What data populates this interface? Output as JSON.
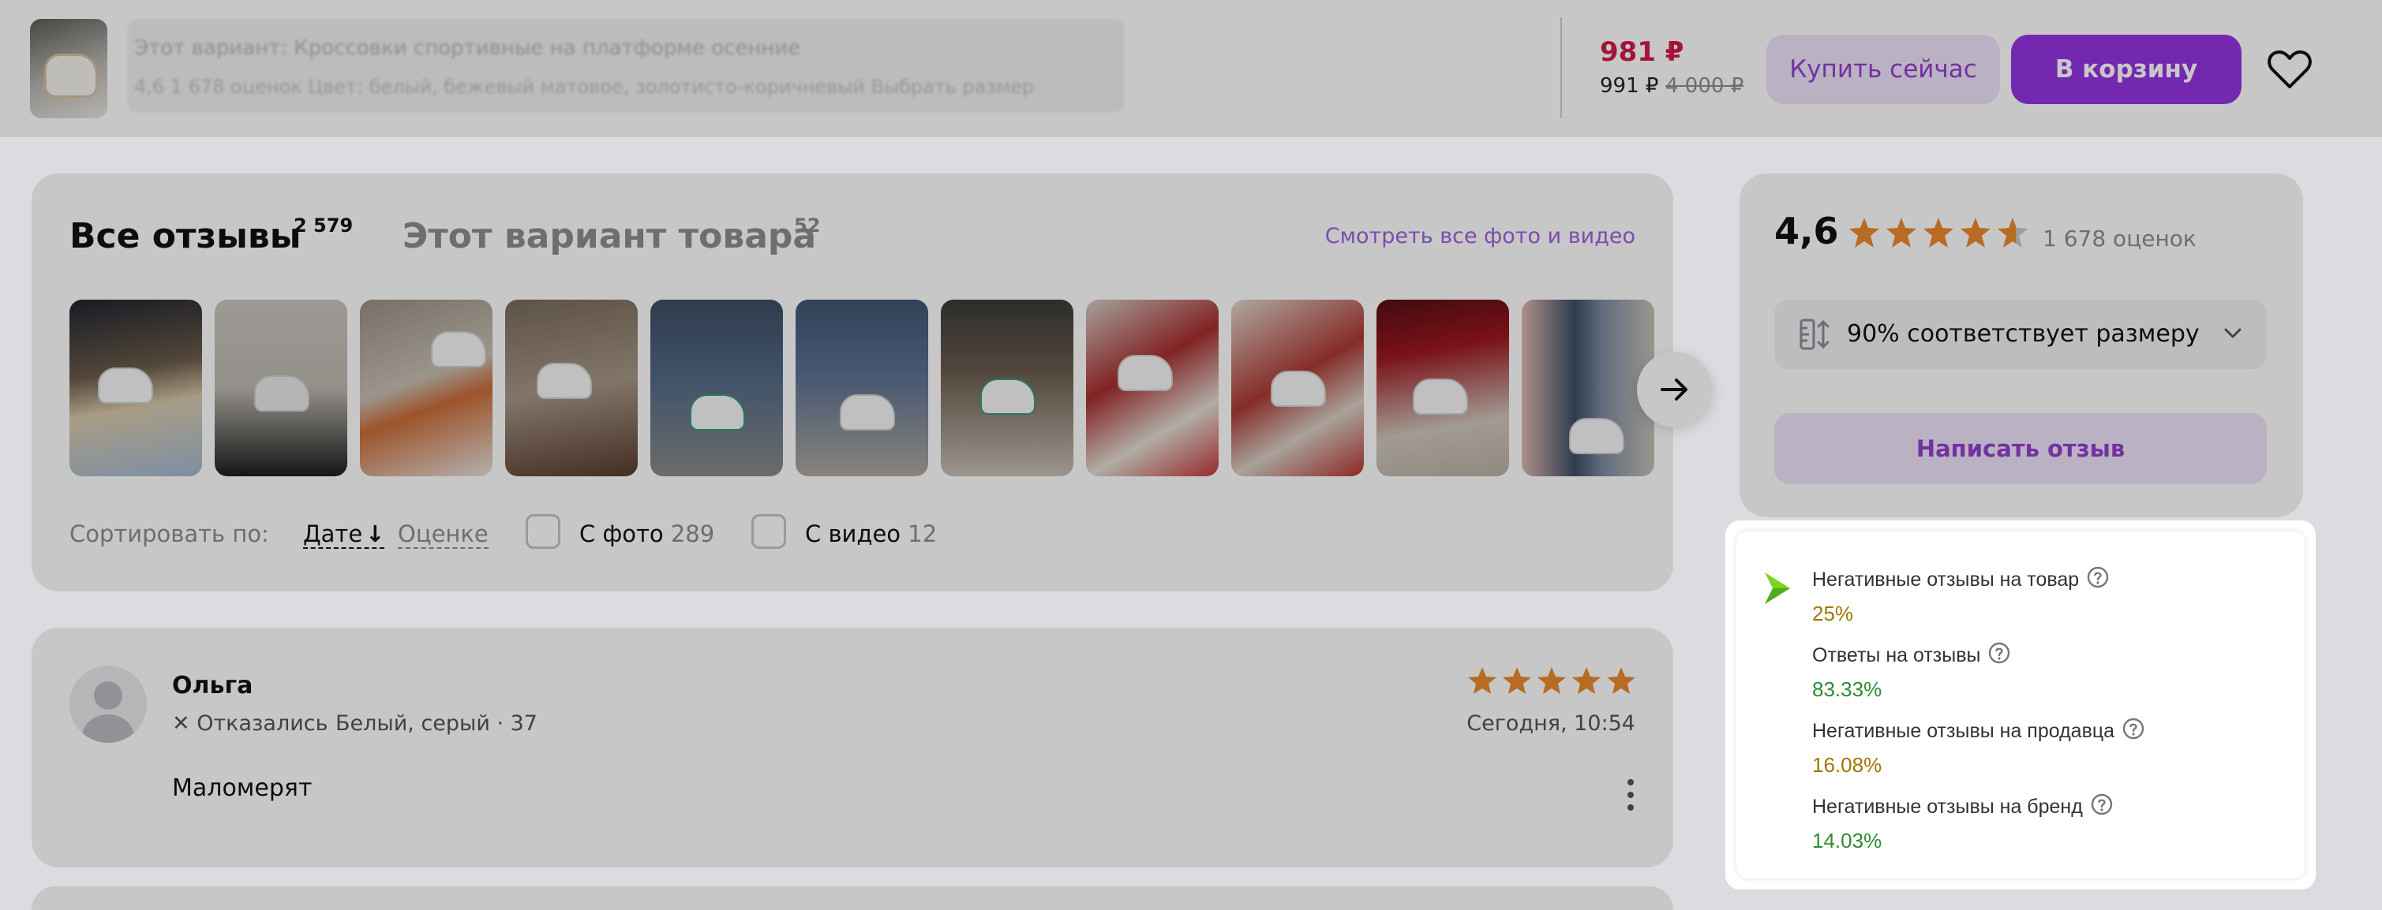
{
  "topbar": {
    "blurred_title": "Этот вариант: Кроссовки спортивные на платформе осенние",
    "blurred_meta": "4,6  1 678 оценок   Цвет: белый, бежевый матовое, золотисто-коричневый   Выбрать размер",
    "price_current": "981 ₽",
    "price_card": "991 ₽",
    "price_old": "4 000 ₽",
    "buy_now_label": "Купить сейчас",
    "add_to_cart_label": "В корзину"
  },
  "reviews_header": {
    "tab_all_label": "Все отзывы",
    "tab_all_count": "2 579",
    "tab_variant_label": "Этот вариант товара",
    "tab_variant_count": "52",
    "see_all_link": "Смотреть все фото и видео",
    "sort_label": "Сортировать по:",
    "sort_date": "Дате",
    "sort_arrow": "↓",
    "sort_rating": "Оценке",
    "filter_photo_label": "С фото",
    "filter_photo_count": "289",
    "filter_video_label": "С видео",
    "filter_video_count": "12"
  },
  "review": {
    "author": "Ольга",
    "status": "✕ Отказались",
    "variant": "Белый, серый · 37",
    "date": "Сегодня, 10:54",
    "text": "Маломерят",
    "stars": 5
  },
  "rating": {
    "value": "4,6",
    "stars": 4.6,
    "count": "1 678 оценок",
    "size_fit": "90% соответствует размеру",
    "write_review_label": "Написать отзыв"
  },
  "stats": [
    {
      "label": "Негативные отзывы на товар",
      "value": "25%",
      "color": "#a07800"
    },
    {
      "label": "Ответы на отзывы",
      "value": "83.33%",
      "color": "#2e8b34"
    },
    {
      "label": "Негативные отзывы на продавца",
      "value": "16.08%",
      "color": "#a07800"
    },
    {
      "label": "Негативные отзывы на бренд",
      "value": "14.03%",
      "color": "#2e8b34"
    }
  ],
  "colors": {
    "accent": "#9c2ff2",
    "accent_light": "#f0e2fb",
    "price": "#e2154a",
    "star": "#f6871f",
    "logo": "#7ed321"
  }
}
